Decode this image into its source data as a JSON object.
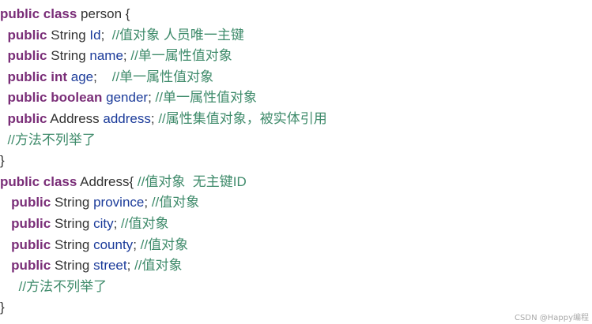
{
  "lines": [
    {
      "i": "",
      "kw": "public class",
      "ty": " person {",
      "fld": "",
      "pu": "",
      "cm": ""
    },
    {
      "i": "  ",
      "kw": "public",
      "ty": " String ",
      "fld": "Id",
      "pu": ";  ",
      "cm": "//值对象 人员唯一主键"
    },
    {
      "i": "  ",
      "kw": "public",
      "ty": " String ",
      "fld": "name",
      "pu": "; ",
      "cm": "//单一属性值对象"
    },
    {
      "i": "  ",
      "kw": "public int",
      "ty": " ",
      "fld": "age",
      "pu": ";    ",
      "cm": "//单一属性值对象"
    },
    {
      "i": "  ",
      "kw": "public boolean",
      "ty": " ",
      "fld": "gender",
      "pu": "; ",
      "cm": "//单一属性值对象"
    },
    {
      "i": "  ",
      "kw": "public",
      "ty": " Address ",
      "fld": "address",
      "pu": "; ",
      "cm": "//属性集值对象，被实体引用"
    },
    {
      "i": "  ",
      "kw": "",
      "ty": "",
      "fld": "",
      "pu": "",
      "cm": "//方法不列举了"
    },
    {
      "i": "",
      "kw": "",
      "ty": "}",
      "fld": "",
      "pu": "",
      "cm": ""
    },
    {
      "i": "",
      "kw": "public class",
      "ty": " Address{ ",
      "fld": "",
      "pu": "",
      "cm": "//值对象  无主键ID"
    },
    {
      "i": "   ",
      "kw": "public",
      "ty": " String ",
      "fld": "province",
      "pu": "; ",
      "cm": "//值对象"
    },
    {
      "i": "   ",
      "kw": "public",
      "ty": " String ",
      "fld": "city",
      "pu": "; ",
      "cm": "//值对象"
    },
    {
      "i": "   ",
      "kw": "public",
      "ty": " String ",
      "fld": "county",
      "pu": "; ",
      "cm": "//值对象"
    },
    {
      "i": "   ",
      "kw": "public",
      "ty": " String ",
      "fld": "street",
      "pu": "; ",
      "cm": "//值对象"
    },
    {
      "i": "     ",
      "kw": "",
      "ty": "",
      "fld": "",
      "pu": "",
      "cm": "//方法不列举了"
    },
    {
      "i": "",
      "kw": "",
      "ty": "}",
      "fld": "",
      "pu": "",
      "cm": ""
    }
  ],
  "watermark": "CSDN @Happy编程",
  "colors": {
    "keyword": "#7a2e78",
    "field": "#1b3b9a",
    "comment": "#3f8b6b",
    "text": "#333333",
    "background": "#ffffff"
  }
}
